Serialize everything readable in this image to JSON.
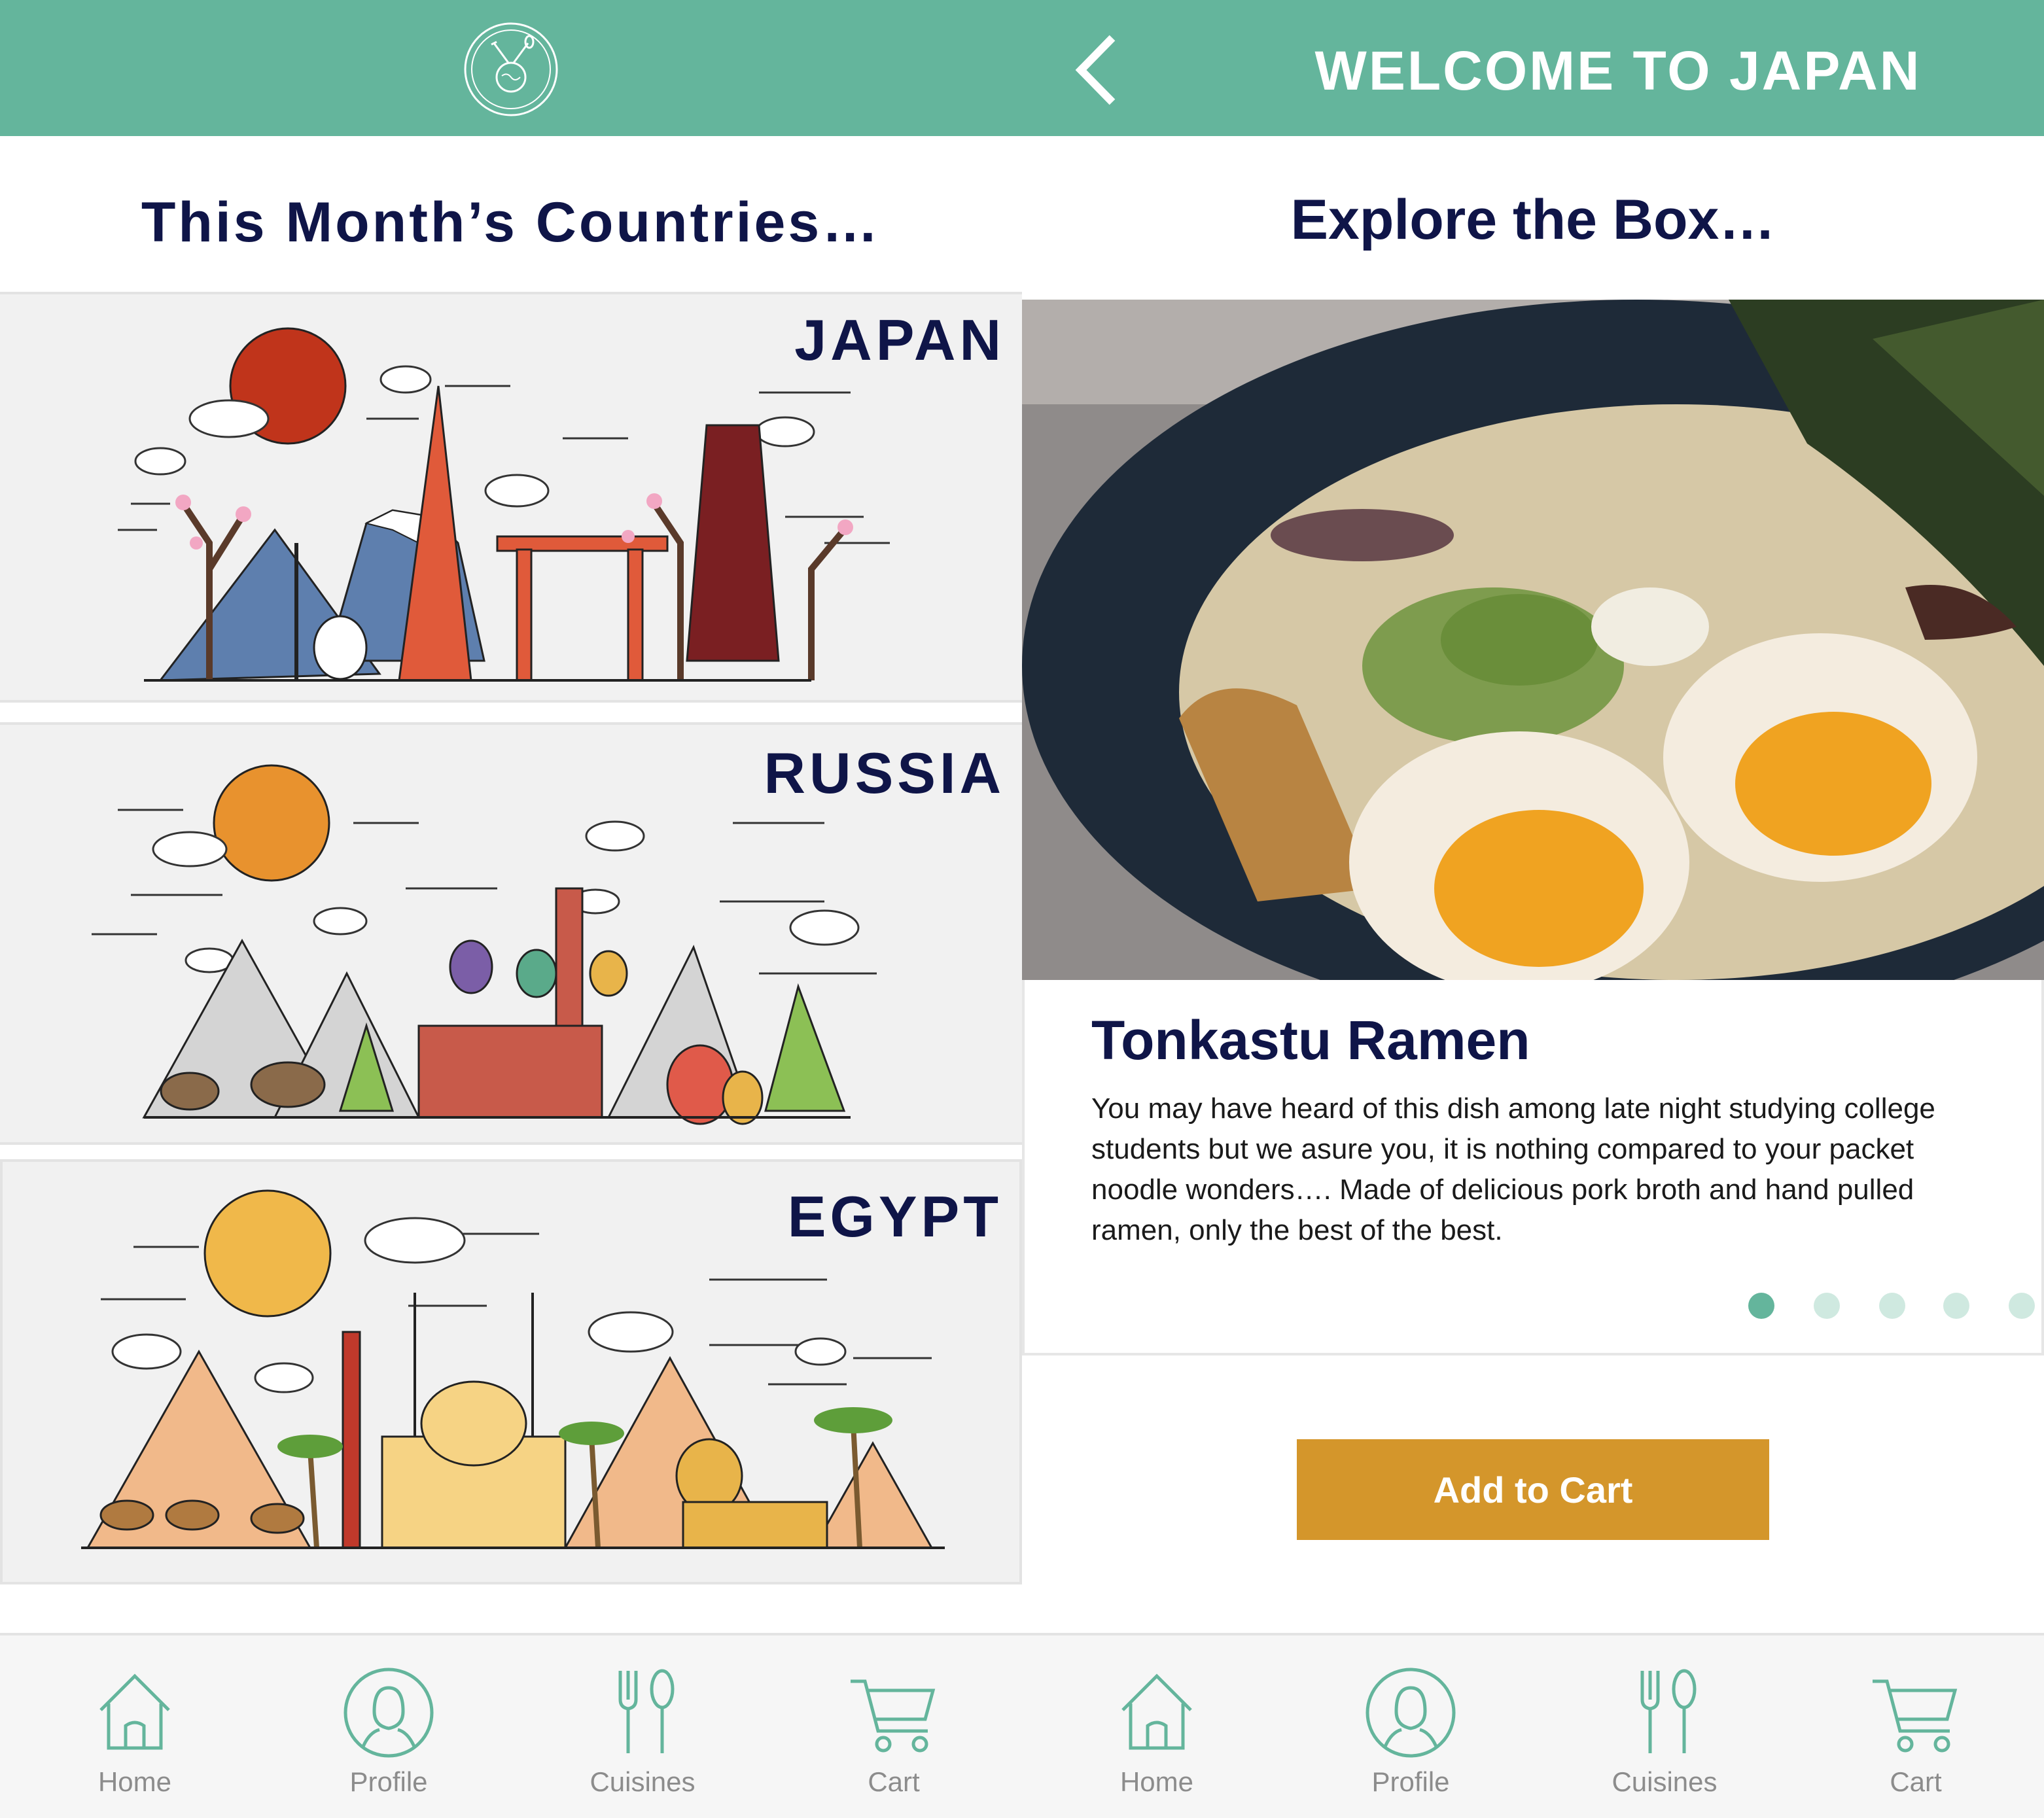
{
  "left_screen": {
    "header": {
      "logo_icon": "globe-utensils-logo-icon"
    },
    "section_title": "This Month’s Countries…",
    "countries": [
      {
        "name": "JAPAN",
        "sun_color": "#c0341b"
      },
      {
        "name": "RUSSIA",
        "sun_color": "#e8922e"
      },
      {
        "name": "EGYPT",
        "sun_color": "#f0b84a"
      }
    ]
  },
  "right_screen": {
    "header": {
      "back_icon": "chevron-left-icon",
      "title": "WELCOME TO JAPAN"
    },
    "section_title": "Explore the Box…",
    "carousel": {
      "item_name": "Tonkastu Ramen",
      "description": "You may have heard of this dish among late night studying college students but we asure you, it is nothing compared to your packet noodle wonders…. Made of delicious pork broth and hand pulled ramen, only the best of the best.",
      "page_count": 5,
      "active_index": 0
    },
    "add_to_cart_label": "Add to Cart"
  },
  "tab_bar": [
    {
      "label": "Home",
      "icon": "home-icon"
    },
    {
      "label": "Profile",
      "icon": "profile-icon"
    },
    {
      "label": "Cuisines",
      "icon": "fork-spoon-icon"
    },
    {
      "label": "Cart",
      "icon": "cart-icon"
    }
  ],
  "colors": {
    "brand_green": "#64b59c",
    "title_navy": "#0f1548",
    "button_gold": "#d4962b",
    "dot_active": "#64b59c",
    "dot_inactive": "#cfe9e0",
    "tab_icon": "#64b59c"
  }
}
